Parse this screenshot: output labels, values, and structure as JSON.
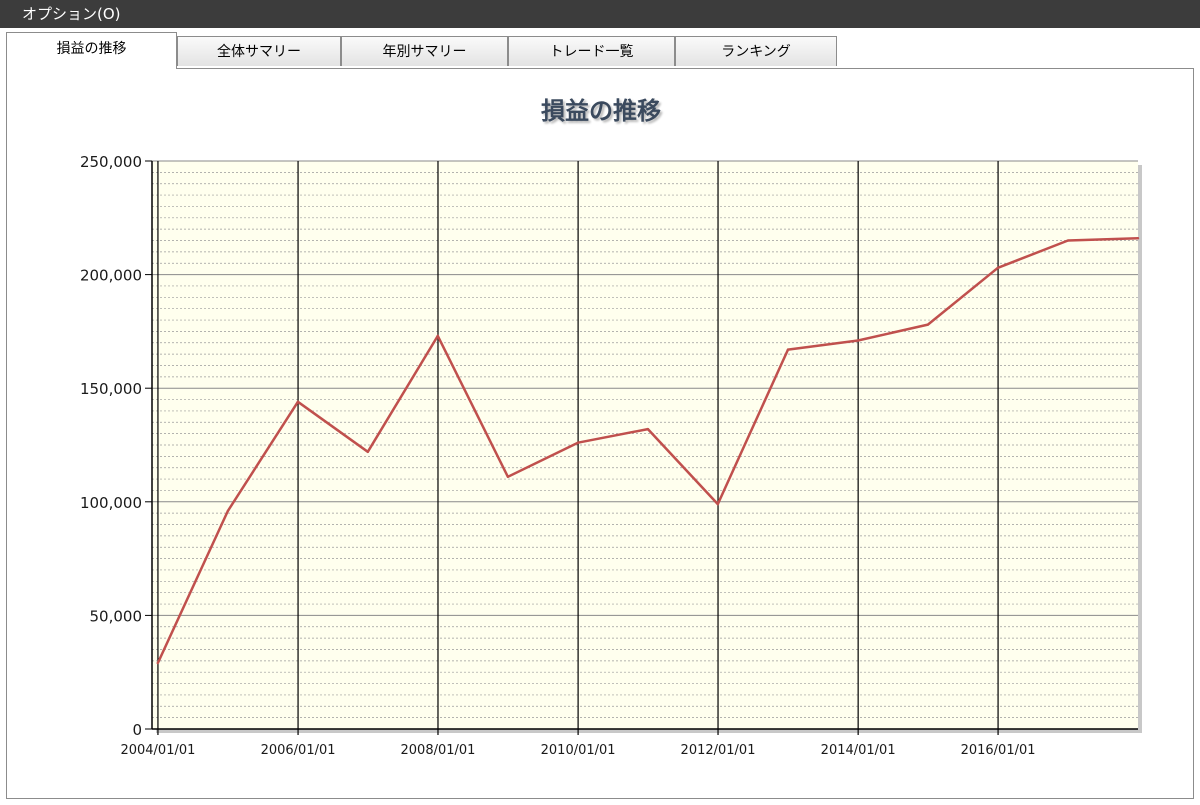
{
  "menubar": {
    "options_label": "オプション(O)"
  },
  "tabs": [
    {
      "label": "損益の推移",
      "active": true
    },
    {
      "label": "全体サマリー",
      "active": false
    },
    {
      "label": "年別サマリー",
      "active": false
    },
    {
      "label": "トレード一覧",
      "active": false
    },
    {
      "label": "ランキング",
      "active": false
    }
  ],
  "colors": {
    "line": "#c0504d",
    "plot_background": "#ffffee",
    "title": "#3b4a5e",
    "menubar": "#3c3c3c"
  },
  "chart_data": {
    "type": "line",
    "title": "損益の推移",
    "xlabel": "",
    "ylabel": "",
    "ylim": [
      0,
      250000
    ],
    "xlim": [
      "2003-12-01",
      "2017-12-31"
    ],
    "grid": true,
    "legend": "none",
    "y_ticks": [
      "0",
      "50,000",
      "100,000",
      "150,000",
      "200,000",
      "250,000"
    ],
    "x_ticks": [
      "2004/01/01",
      "2006/01/01",
      "2008/01/01",
      "2010/01/01",
      "2012/01/01",
      "2014/01/01",
      "2016/01/01"
    ],
    "series": [
      {
        "x": [
          "2003-12-31",
          "2004-12-31",
          "2005-12-31",
          "2006-12-31",
          "2007-12-31",
          "2008-12-31",
          "2009-12-31",
          "2010-12-31",
          "2011-12-31",
          "2012-12-31",
          "2013-12-31",
          "2014-12-31",
          "2015-12-31",
          "2016-12-31",
          "2017-12-31"
        ],
        "values": [
          29000,
          96000,
          144000,
          122000,
          173000,
          111000,
          126000,
          132000,
          99000,
          167000,
          171000,
          178000,
          203000,
          215000,
          216000
        ]
      }
    ]
  }
}
